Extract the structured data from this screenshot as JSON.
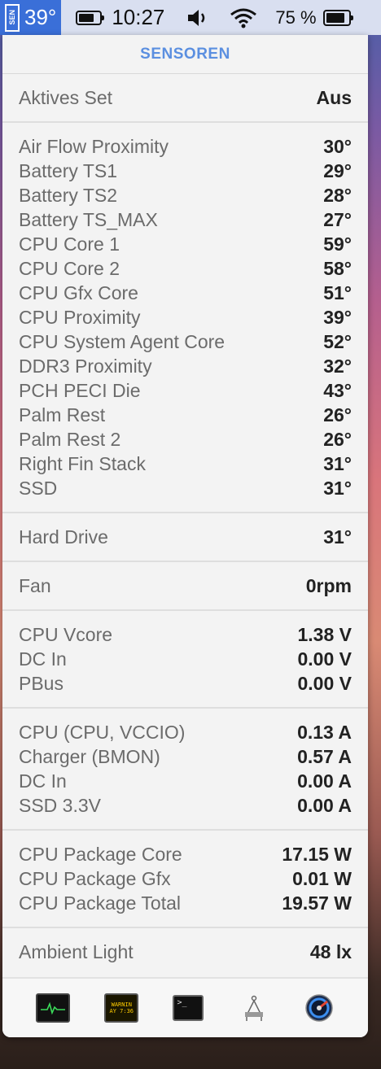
{
  "menubar": {
    "sensor_icon_text": "SEN",
    "sensor_temp": "39°",
    "clock": "10:27",
    "battery_percent": "75 %"
  },
  "panel": {
    "title": "SENSOREN",
    "active_set": {
      "label": "Aktives Set",
      "value": "Aus"
    },
    "temperatures": [
      {
        "label": "Air Flow Proximity",
        "value": "30°"
      },
      {
        "label": "Battery TS1",
        "value": "29°"
      },
      {
        "label": "Battery TS2",
        "value": "28°"
      },
      {
        "label": "Battery TS_MAX",
        "value": "27°"
      },
      {
        "label": "CPU Core 1",
        "value": "59°"
      },
      {
        "label": "CPU Core 2",
        "value": "58°"
      },
      {
        "label": "CPU Gfx Core",
        "value": "51°"
      },
      {
        "label": "CPU Proximity",
        "value": "39°"
      },
      {
        "label": "CPU System Agent Core",
        "value": "52°"
      },
      {
        "label": "DDR3 Proximity",
        "value": "32°"
      },
      {
        "label": "PCH PECI Die",
        "value": "43°"
      },
      {
        "label": "Palm Rest",
        "value": "26°"
      },
      {
        "label": "Palm Rest 2",
        "value": "26°"
      },
      {
        "label": "Right Fin Stack",
        "value": "31°"
      },
      {
        "label": "SSD",
        "value": "31°"
      }
    ],
    "drive": [
      {
        "label": "Hard Drive",
        "value": "31°"
      }
    ],
    "fan": [
      {
        "label": "Fan",
        "value": "0rpm"
      }
    ],
    "voltages": [
      {
        "label": "CPU Vcore",
        "value": "1.38 V"
      },
      {
        "label": "DC In",
        "value": "0.00 V"
      },
      {
        "label": "PBus",
        "value": "0.00 V"
      }
    ],
    "currents": [
      {
        "label": "CPU (CPU, VCCIO)",
        "value": "0.13 A"
      },
      {
        "label": "Charger (BMON)",
        "value": "0.57 A"
      },
      {
        "label": "DC In",
        "value": "0.00 A"
      },
      {
        "label": "SSD 3.3V",
        "value": "0.00 A"
      }
    ],
    "power": [
      {
        "label": "CPU Package Core",
        "value": "17.15 W"
      },
      {
        "label": "CPU Package Gfx",
        "value": "0.01 W"
      },
      {
        "label": "CPU Package Total",
        "value": "19.57 W"
      }
    ],
    "light": [
      {
        "label": "Ambient Light",
        "value": "48 lx"
      }
    ]
  },
  "toolbar": {
    "console_line1": "WARNIN",
    "console_line2": "AY 7:36",
    "terminal_prompt": ">_"
  },
  "icons": {
    "activity_monitor": "activity-monitor-icon",
    "console": "console-icon",
    "terminal": "terminal-icon",
    "system_information": "system-information-icon",
    "disk_utility": "disk-utility-icon"
  }
}
